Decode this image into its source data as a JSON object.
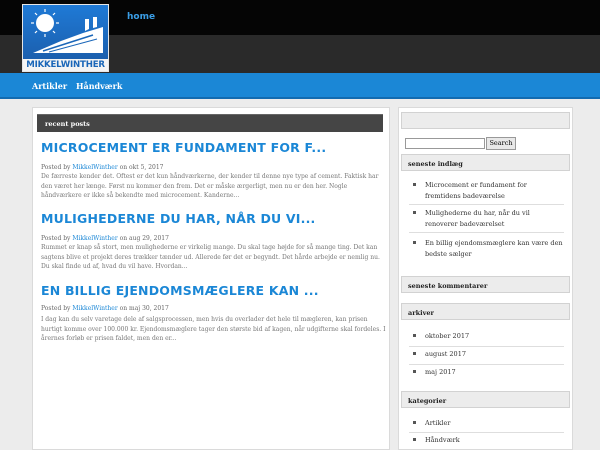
{
  "site": {
    "logo_text": "MIKKELWINTHER",
    "top_link": "home"
  },
  "nav": {
    "items": [
      "Artikler",
      "Håndværk"
    ]
  },
  "main": {
    "section_title": "recent posts",
    "posts": [
      {
        "title": "MICROCEMENT ER FUNDAMENT FOR F...",
        "posted_by_label": "Posted by",
        "author": "MikkelWinther",
        "on_label": "on",
        "date": "okt 5, 2017",
        "excerpt": "De færreste kender det. Oftest er det kun håndværkerne, der kender til denne nye type af cement. Faktisk har den været her længe. Først nu kommer den frem. Det er måske ærgerligt, men nu er den her. Nogle håndværkere er ikke så bekendte med microcement. Kanderne..."
      },
      {
        "title": "MULIGHEDERNE DU HAR, NÅR DU VI...",
        "posted_by_label": "Posted by",
        "author": "MikkelWinther",
        "on_label": "on",
        "date": "aug 29, 2017",
        "excerpt": "Rummet er knap så stort, men mulighederne er virkelig mange. Du skal tage højde for så mange ting. Det kan sagtens blive et projekt deres trækker tænder ud. Allerede før det er begyndt. Det hårde arbejde er nemlig nu. Du skal finde ud af, hvad du vil have. Hvordan..."
      },
      {
        "title": "EN BILLIG EJENDOMSMÆGLERE KAN ...",
        "posted_by_label": "Posted by",
        "author": "MikkelWinther",
        "on_label": "on",
        "date": "maj 30, 2017",
        "excerpt": "I dag kan du selv varetage dele af salgsprocessen, men hvis du overlader det hele til mægleren, kan prisen hurtigt komme over 100.000 kr.   Ejendomsmæglere tager den største bid af kagen, når udgifterne skal fordeles. I årernes forløb er prisen faldet, men den er..."
      }
    ]
  },
  "sidebar": {
    "search_button": "Search",
    "search_value": "",
    "recent_title": "seneste indlæg",
    "recent_items": [
      "Microcement er fundament for fremtidens badeværelse",
      "Mulighederne du har, når du vil renoverer badeværelset",
      "En billig ejendomsmæglere kan være den bedste sælger"
    ],
    "comments_title": "seneste kommentarer",
    "archive_title": "arkiver",
    "archive_items": [
      "oktober 2017",
      "august 2017",
      "maj 2017"
    ],
    "categories_title": "kategorier",
    "category_items": [
      "Artikler",
      "Håndværk"
    ]
  }
}
